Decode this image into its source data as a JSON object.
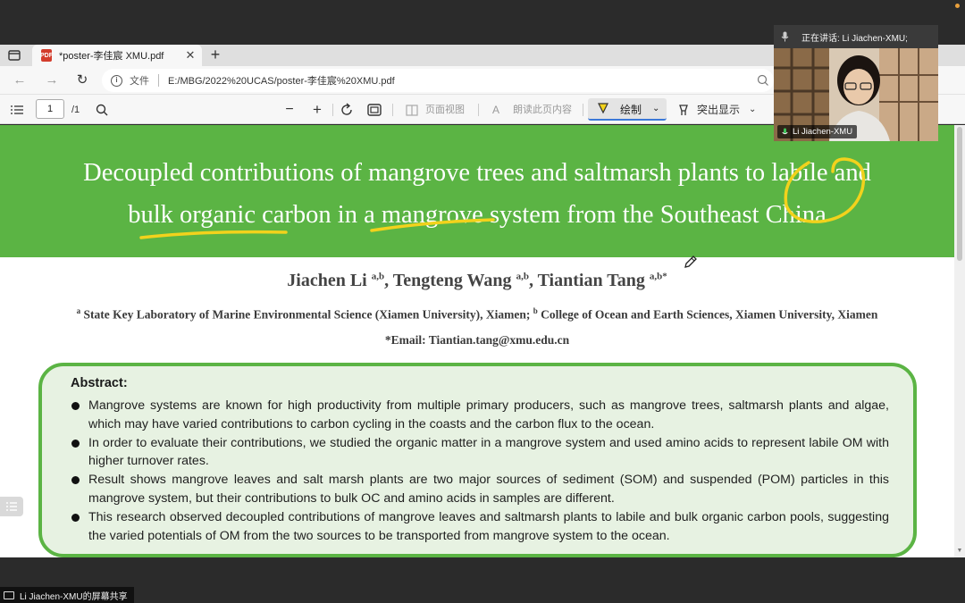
{
  "browser": {
    "tab_title": "*poster-李佳宸 XMU.pdf",
    "tab_icon": "pdf-icon",
    "address_label": "文件",
    "url": "E:/MBG/2022%20UCAS/poster-李佳宸%20XMU.pdf"
  },
  "pdf_toolbar": {
    "page_current": "1",
    "page_total": "/1",
    "page_view_label": "页面视图",
    "read_aloud_label": "朗读此页内容",
    "draw_label": "绘制",
    "highlight_label": "突出显示"
  },
  "document": {
    "title_line1": "Decoupled contributions of mangrove trees and saltmarsh plants to labile and",
    "title_line2": "bulk organic carbon in a mangrove system from the Southeast China",
    "authors": [
      {
        "name": "Jiachen Li",
        "sup": "a,b"
      },
      {
        "name": "Tengteng Wang",
        "sup": "a,b"
      },
      {
        "name": "Tiantian Tang",
        "sup": "a,b*"
      }
    ],
    "affiliation_a_mark": "a",
    "affiliation_a": "State Key Laboratory of Marine Environmental Science (Xiamen University), Xiamen;",
    "affiliation_b_mark": "b",
    "affiliation_b": "College of Ocean and Earth Sciences, Xiamen University, Xiamen",
    "email": "*Email: Tiantian.tang@xmu.edu.cn",
    "abstract_heading": "Abstract:",
    "abstract_bullets": [
      "Mangrove systems are known for high productivity from multiple primary producers, such as mangrove trees, saltmarsh plants and algae, which may have varied contributions to carbon cycling in the coasts and the carbon flux to the ocean.",
      "In order to evaluate their contributions, we studied the organic matter in a mangrove system and used amino acids to represent labile OM with higher turnover rates.",
      "Result shows mangrove leaves and salt marsh plants are two major sources of sediment (SOM) and suspended (POM) particles in this mangrove system, but their contributions to bulk OC and amino acids in samples are different.",
      "This research observed decoupled contributions of mangrove leaves and saltmarsh plants to labile and bulk organic carbon pools, suggesting the varied potentials of OM from the two sources to be transported from mangrove system to the ocean."
    ]
  },
  "meeting": {
    "speaking_label": "正在讲话: Li Jiachen-XMU;",
    "video_participant": "Li Jiachen-XMU",
    "screen_share_label": "Li Jiachen-XMU的屏幕共享"
  },
  "colors": {
    "title_band": "#5bb444",
    "abstract_fill": "#e7f2e2",
    "annotation_ink": "#f2d21c",
    "draw_underline": "#3b78d8"
  }
}
